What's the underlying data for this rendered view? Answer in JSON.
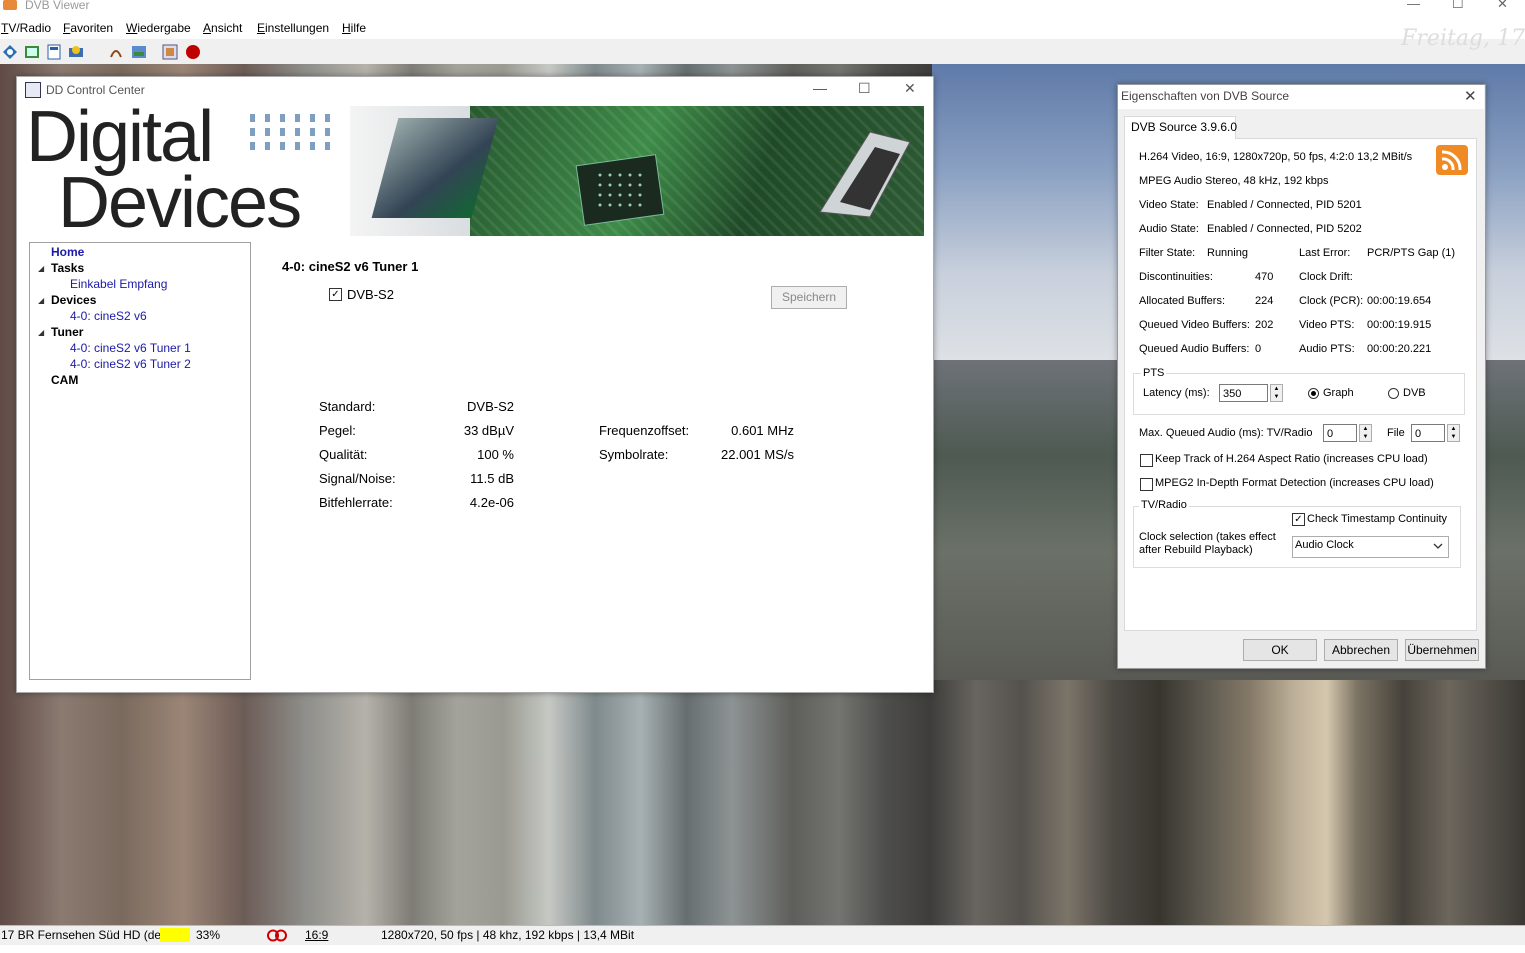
{
  "app": {
    "title": "DVB Viewer",
    "date_overlay": "Freitag, 17",
    "menu": [
      "TV/Radio",
      "Favoriten",
      "Wiedergabe",
      "Ansicht",
      "Einstellungen",
      "Hilfe"
    ]
  },
  "statusbar": {
    "channel": "17 BR Fernsehen Süd HD (deu",
    "level": "33%",
    "aspect": "16:9",
    "stream_info": "1280x720, 50 fps | 48 khz, 192 kbps | 13,4 MBit"
  },
  "ddcc": {
    "title": "DD Control Center",
    "logo_line1": "Digital",
    "logo_line2": "Devices",
    "tree": {
      "home": "Home",
      "tasks": "Tasks",
      "task_item": "Einkabel Empfang",
      "devices": "Devices",
      "device_item": "4-0: cineS2 v6",
      "tuner": "Tuner",
      "tuner_item1": "4-0: cineS2 v6 Tuner 1",
      "tuner_item2": "4-0: cineS2 v6 Tuner 2",
      "cam": "CAM"
    },
    "heading": "4-0: cineS2 v6 Tuner 1",
    "dvbs2_label": "DVB-S2",
    "save_label": "Speichern",
    "stats": {
      "standard_label": "Standard:",
      "standard_value": "DVB-S2",
      "pegel_label": "Pegel:",
      "pegel_value": "33 dBµV",
      "qualitaet_label": "Qualität:",
      "qualitaet_value": "100 %",
      "snr_label": "Signal/Noise:",
      "snr_value": "11.5 dB",
      "ber_label": "Bitfehlerrate:",
      "ber_value": "4.2e-06",
      "freq_label": "Frequenzoffset:",
      "freq_value": "0.601 MHz",
      "symbol_label": "Symbolrate:",
      "symbol_value": "22.001 MS/s"
    }
  },
  "props": {
    "title": "Eigenschaften von DVB Source",
    "tab": "DVB Source 3.9.6.0",
    "video_info": "H.264 Video, 16:9, 1280x720p, 50 fps, 4:2:0   13,2 MBit/s",
    "audio_info": "MPEG Audio Stereo, 48 kHz, 192 kbps",
    "video_state_label": "Video State:",
    "video_state": "Enabled / Connected, PID 5201",
    "audio_state_label": "Audio State:",
    "audio_state": "Enabled / Connected, PID 5202",
    "filter_state_label": "Filter State:",
    "filter_state": "Running",
    "last_error_label": "Last Error:",
    "last_error": "PCR/PTS Gap (1)",
    "disc_label": "Discontinuities:",
    "disc_value": "470",
    "clock_drift_label": "Clock Drift:",
    "alloc_label": "Allocated Buffers:",
    "alloc_value": "224",
    "clock_pcr_label": "Clock (PCR):",
    "clock_pcr": "00:00:19.654",
    "qvb_label": "Queued Video Buffers:",
    "qvb_value": "202",
    "video_pts_label": "Video PTS:",
    "video_pts": "00:00:19.915",
    "qab_label": "Queued Audio Buffers:",
    "qab_value": "0",
    "audio_pts_label": "Audio PTS:",
    "audio_pts": "00:00:20.221",
    "pts_group": "PTS",
    "latency_label": "Latency (ms):",
    "latency_value": "350",
    "radio_graph": "Graph",
    "radio_dvb": "DVB",
    "max_queued_label": "Max. Queued Audio (ms): TV/Radio",
    "max_queued_value": "0",
    "file_label": "File",
    "file_value": "0",
    "keep_track": "Keep Track of H.264 Aspect Ratio (increases CPU load)",
    "mpeg2_detect": "MPEG2 In-Depth Format Detection (increases CPU load)",
    "tvradio_group": "TV/Radio",
    "check_ts": "Check Timestamp Continuity",
    "clock_sel_line1": "Clock selection (takes effect",
    "clock_sel_line2": "after Rebuild Playback)",
    "clock_value": "Audio Clock",
    "ok": "OK",
    "cancel": "Abbrechen",
    "apply": "Übernehmen"
  }
}
